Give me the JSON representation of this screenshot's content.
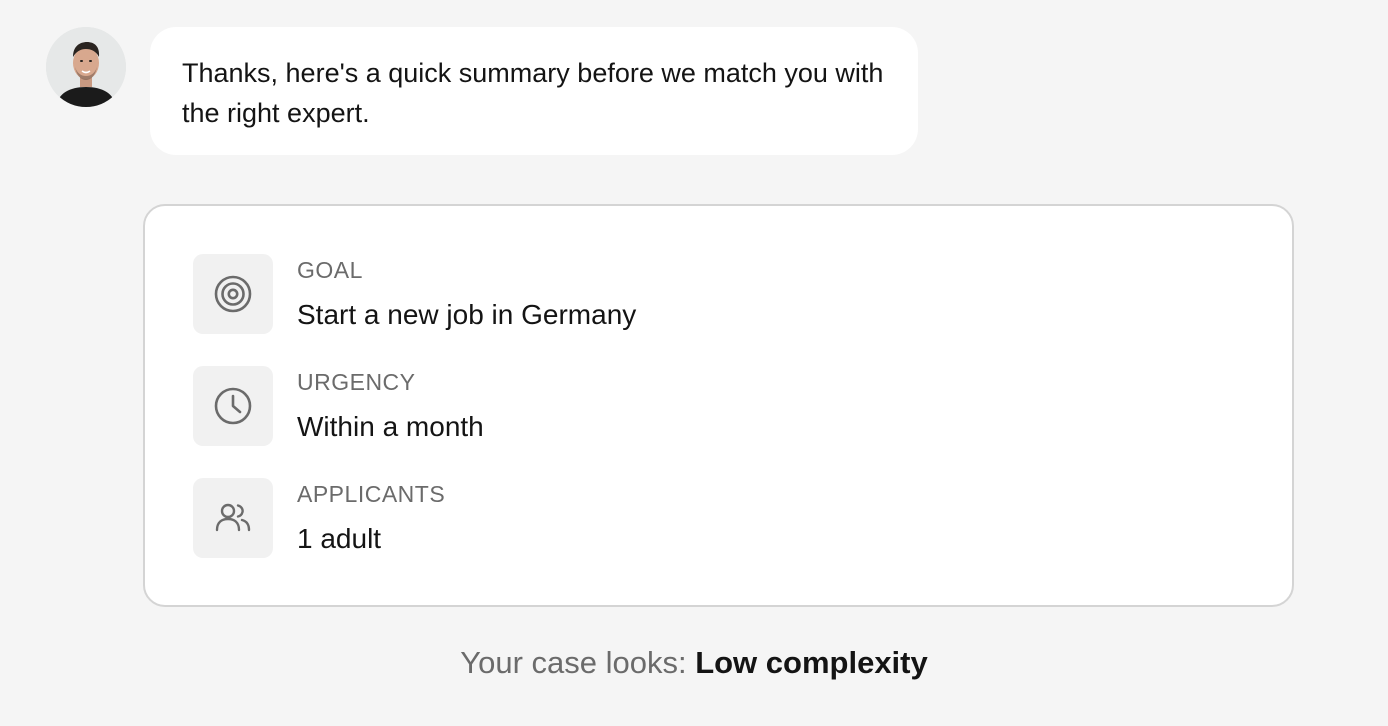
{
  "chat": {
    "message": "Thanks, here's a quick summary before we match you with the right expert."
  },
  "summary": {
    "rows": [
      {
        "icon": "target-icon",
        "label": "GOAL",
        "value": "Start a new job in Germany"
      },
      {
        "icon": "clock-icon",
        "label": "URGENCY",
        "value": "Within a month"
      },
      {
        "icon": "users-icon",
        "label": "APPLICANTS",
        "value": "1 adult"
      }
    ]
  },
  "complexity": {
    "prefix": "Your case looks: ",
    "value": "Low complexity"
  },
  "colors": {
    "background": "#f5f5f5",
    "card": "#ffffff",
    "border": "#d4d4d4",
    "icon_tile": "#f1f1f1",
    "icon": "#6b6b6b",
    "muted_text": "#6b6b6b",
    "text": "#141414"
  }
}
